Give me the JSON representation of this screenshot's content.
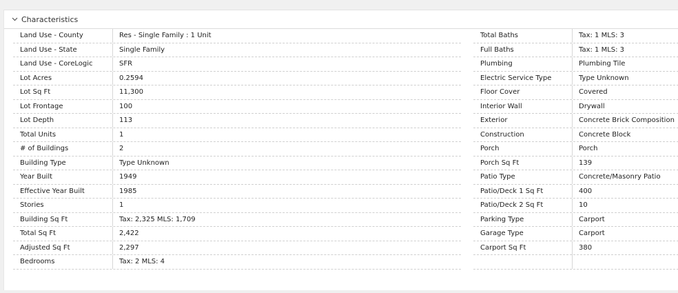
{
  "section": {
    "title": "Characteristics",
    "toggle_icon": "chevron-down-icon"
  },
  "left_rows": [
    {
      "label": "Land Use - County",
      "value": "Res - Single Family : 1 Unit"
    },
    {
      "label": "Land Use - State",
      "value": "Single Family"
    },
    {
      "label": "Land Use - CoreLogic",
      "value": "SFR"
    },
    {
      "label": "Lot Acres",
      "value": "0.2594"
    },
    {
      "label": "Lot Sq Ft",
      "value": "11,300"
    },
    {
      "label": "Lot Frontage",
      "value": "100"
    },
    {
      "label": "Lot Depth",
      "value": "113"
    },
    {
      "label": "Total Units",
      "value": "1"
    },
    {
      "label": "# of Buildings",
      "value": "2"
    },
    {
      "label": "Building Type",
      "value": "Type Unknown"
    },
    {
      "label": "Year Built",
      "value": "1949"
    },
    {
      "label": "Effective Year Built",
      "value": "1985"
    },
    {
      "label": "Stories",
      "value": "1"
    },
    {
      "label": "Building Sq Ft",
      "value": "Tax: 2,325 MLS: 1,709"
    },
    {
      "label": "Total Sq Ft",
      "value": "2,422"
    },
    {
      "label": "Adjusted Sq Ft",
      "value": "2,297"
    },
    {
      "label": "Bedrooms",
      "value": "Tax: 2 MLS: 4"
    }
  ],
  "right_rows": [
    {
      "label": "Total Baths",
      "value": "Tax: 1 MLS: 3"
    },
    {
      "label": "Full Baths",
      "value": "Tax: 1 MLS: 3"
    },
    {
      "label": "Plumbing",
      "value": "Plumbing Tile"
    },
    {
      "label": "Electric Service Type",
      "value": "Type Unknown"
    },
    {
      "label": "Floor Cover",
      "value": "Covered"
    },
    {
      "label": "Interior Wall",
      "value": "Drywall"
    },
    {
      "label": "Exterior",
      "value": "Concrete Brick Composition"
    },
    {
      "label": "Construction",
      "value": "Concrete Block"
    },
    {
      "label": "Porch",
      "value": "Porch"
    },
    {
      "label": "Porch Sq Ft",
      "value": "139"
    },
    {
      "label": "Patio Type",
      "value": "Concrete/Masonry Patio"
    },
    {
      "label": "Patio/Deck 1 Sq Ft",
      "value": "400"
    },
    {
      "label": "Patio/Deck 2 Sq Ft",
      "value": "10"
    },
    {
      "label": "Parking Type",
      "value": "Carport"
    },
    {
      "label": "Garage Type",
      "value": "Carport"
    },
    {
      "label": "Carport Sq Ft",
      "value": "380"
    },
    {
      "label": "",
      "value": ""
    }
  ]
}
